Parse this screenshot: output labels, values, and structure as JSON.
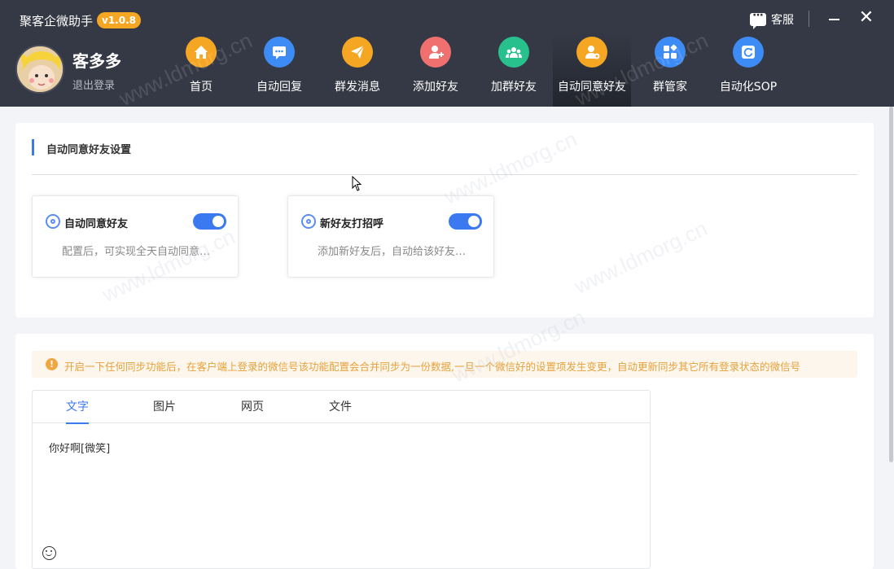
{
  "app": {
    "title": "聚客企微助手",
    "version": "v1.0.8"
  },
  "window": {
    "service_label": "客服",
    "close_glyph": "✕"
  },
  "user": {
    "name": "客多多",
    "logout": "退出登录"
  },
  "nav": [
    {
      "label": "首页",
      "icon": "home-icon",
      "color": "#f5a623"
    },
    {
      "label": "自动回复",
      "icon": "chat-icon",
      "color": "#3d8cf5"
    },
    {
      "label": "群发消息",
      "icon": "send-icon",
      "color": "#f5a623"
    },
    {
      "label": "添加好友",
      "icon": "add-user-icon",
      "color": "#f07070"
    },
    {
      "label": "加群好友",
      "icon": "group-icon",
      "color": "#28c08c"
    },
    {
      "label": "自动同意好友",
      "icon": "user-check-icon",
      "color": "#f5a623"
    },
    {
      "label": "群管家",
      "icon": "apps-icon",
      "color": "#3d8cf5"
    },
    {
      "label": "自动化SOP",
      "icon": "refresh-icon",
      "color": "#3d8cf5"
    }
  ],
  "settings": {
    "title": "自动同意好友设置",
    "features": [
      {
        "name": "自动同意好友",
        "desc": "配置后，可实现全天自动同意…",
        "enabled": true
      },
      {
        "name": "新好友打招呼",
        "desc": "添加新好友后，自动给该好友…",
        "enabled": true
      }
    ]
  },
  "notice": {
    "icon": "!",
    "text": "开启一下任何同步功能后，在客户端上登录的微信号该功能配置会合并同步为一份数据,一旦一个微信好的设置项发生变更，自动更新同步其它所有登录状态的微信号"
  },
  "editor": {
    "tabs": [
      "文字",
      "图片",
      "网页",
      "文件"
    ],
    "active_tab": "文字",
    "content": "你好啊[微笑]"
  },
  "watermark": "www.ldmorg.cn"
}
